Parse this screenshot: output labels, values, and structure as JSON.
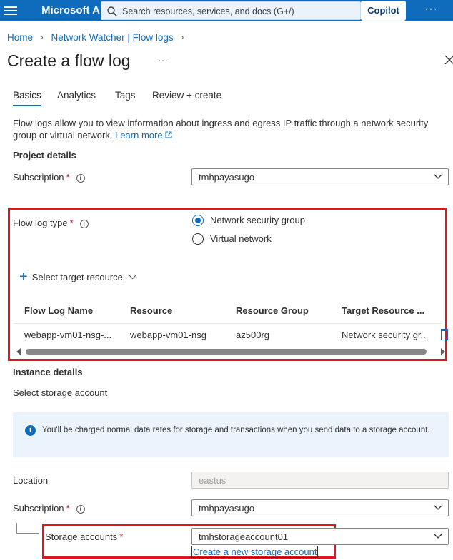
{
  "topbar": {
    "brand": "Microsoft A...",
    "search_placeholder": "Search resources, services, and docs (G+/)",
    "copilot_label": "Copilot",
    "more_label": "···"
  },
  "breadcrumb": {
    "home": "Home",
    "parent": "Network Watcher | Flow logs"
  },
  "page": {
    "title": "Create a flow log",
    "more_label": "···"
  },
  "tabs": [
    "Basics",
    "Analytics",
    "Tags",
    "Review + create"
  ],
  "description": {
    "text": "Flow logs allow you to view information about ingress and egress IP traffic through a network security group or virtual network.",
    "link": "Learn more"
  },
  "project": {
    "heading": "Project details",
    "subscription_label": "Subscription",
    "subscription_value": "tmhpayasugo"
  },
  "flowlog": {
    "type_label": "Flow log type",
    "options": [
      "Network security group",
      "Virtual network"
    ],
    "selected": "Network security group",
    "select_target_label": "Select target resource",
    "table": {
      "headers": [
        "Flow Log Name",
        "Resource",
        "Resource Group",
        "Target Resource ..."
      ],
      "rows": [
        [
          "webapp-vm01-nsg-...",
          "webapp-vm01-nsg",
          "az500rg",
          "Network security gr..."
        ]
      ]
    }
  },
  "instance": {
    "heading": "Instance details",
    "storage_heading": "Select storage account",
    "notice": "You'll be charged normal data rates for storage and transactions when you send data to a storage account.",
    "location_label": "Location",
    "location_value": "eastus",
    "subscription_label": "Subscription",
    "subscription_value": "tmhpayasugo",
    "storage_label": "Storage accounts",
    "storage_value": "tmhstorageaccount01",
    "create_storage_link": "Create a new storage account"
  },
  "colors": {
    "accent": "#0f6cbd",
    "highlight": "#e0161e",
    "required": "#c50f1f"
  }
}
